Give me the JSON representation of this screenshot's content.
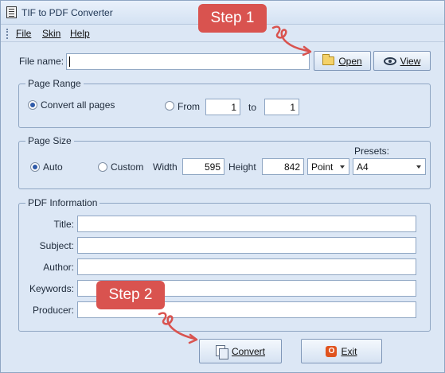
{
  "window": {
    "title": "TIF to PDF Converter"
  },
  "menu": {
    "items": [
      {
        "label": "File"
      },
      {
        "label": "Skin"
      },
      {
        "label": "Help"
      }
    ]
  },
  "file": {
    "label": "File name:",
    "value": "",
    "open_label": "Open",
    "view_label": "View"
  },
  "page_range": {
    "group_title": "Page Range",
    "convert_all_label": "Convert all pages",
    "convert_all_checked": true,
    "from_label": "From",
    "from_value": "1",
    "to_label": "to",
    "to_value": "1"
  },
  "page_size": {
    "group_title": "Page Size",
    "auto_label": "Auto",
    "auto_checked": true,
    "custom_label": "Custom",
    "width_label": "Width",
    "width_value": "595",
    "height_label": "Height",
    "height_value": "842",
    "unit_value": "Point",
    "presets_label": "Presets:",
    "preset_value": "A4"
  },
  "pdf_info": {
    "group_title": "PDF Information",
    "title_label": "Title:",
    "title_value": "",
    "subject_label": "Subject:",
    "subject_value": "",
    "author_label": "Author:",
    "author_value": "",
    "keywords_label": "Keywords:",
    "keywords_value": "",
    "producer_label": "Producer:",
    "producer_value": ""
  },
  "actions": {
    "convert_label": "Convert",
    "exit_label": "Exit"
  },
  "annotations": {
    "step1": "Step 1",
    "step2": "Step 2"
  },
  "colors": {
    "step_badge": "#d9534f",
    "window_bg": "#dce7f5",
    "border": "#8fa6c3",
    "radio_dot": "#2f5aa8"
  },
  "icons": {
    "open": "folder-icon",
    "view": "eye-icon",
    "convert": "convert-icon",
    "exit": "exit-icon",
    "app": "app-icon"
  }
}
